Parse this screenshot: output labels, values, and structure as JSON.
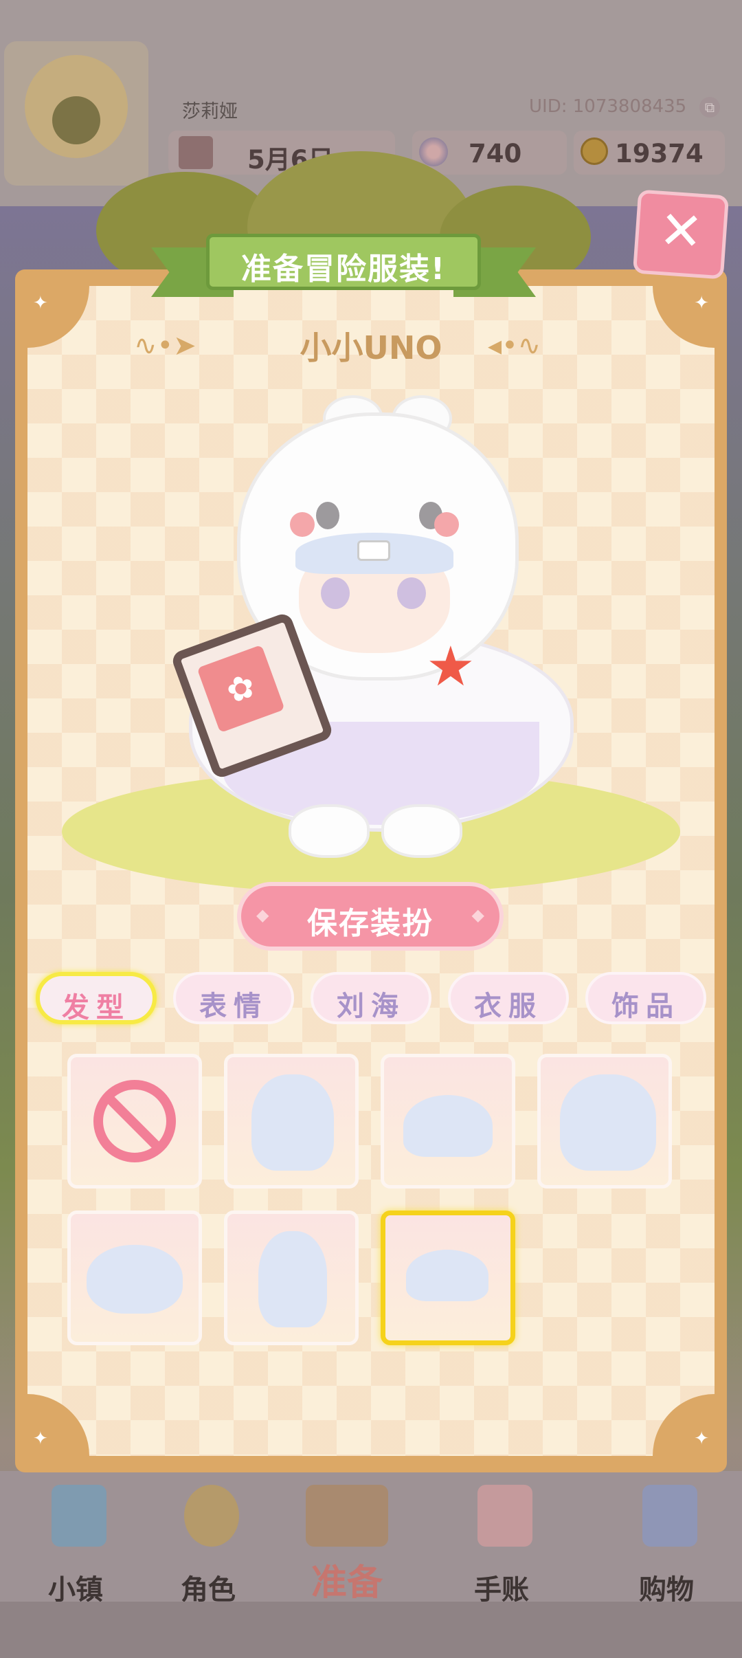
{
  "header": {
    "player_name": "莎莉娅",
    "uid": "UID: 1073808435",
    "date": "5月6日",
    "gems": "740",
    "coins": "19374"
  },
  "panel": {
    "title": "准备冒险服装!",
    "character_name": "小小UNO",
    "save_button": "保存装扮",
    "close_label": "✕"
  },
  "tabs": [
    {
      "label": "发型",
      "active": true
    },
    {
      "label": "表情",
      "active": false
    },
    {
      "label": "刘海",
      "active": false
    },
    {
      "label": "衣服",
      "active": false
    },
    {
      "label": "饰品",
      "active": false
    }
  ],
  "items": [
    {
      "icon": "none-icon",
      "selected": false
    },
    {
      "icon": "long-hair-icon",
      "selected": false
    },
    {
      "icon": "short-hair-icon",
      "selected": false
    },
    {
      "icon": "twin-hair-icon",
      "selected": false
    },
    {
      "icon": "bob-hair-icon",
      "selected": false
    },
    {
      "icon": "pigtail-hair-icon",
      "selected": false
    },
    {
      "icon": "bun-hair-icon",
      "selected": true
    }
  ],
  "bottom_nav": [
    {
      "label": "小镇",
      "icon": "map-icon"
    },
    {
      "label": "角色",
      "icon": "character-icon"
    },
    {
      "label": "准备",
      "icon": "basket-icon"
    },
    {
      "label": "手账",
      "icon": "notebook-icon"
    },
    {
      "label": "购物",
      "icon": "shopping-bag-icon"
    }
  ],
  "colors": {
    "accent_pink": "#f595a6",
    "ribbon_green": "#9fc760",
    "selected_yellow": "#f5d21b",
    "panel_frame": "#dca866"
  }
}
